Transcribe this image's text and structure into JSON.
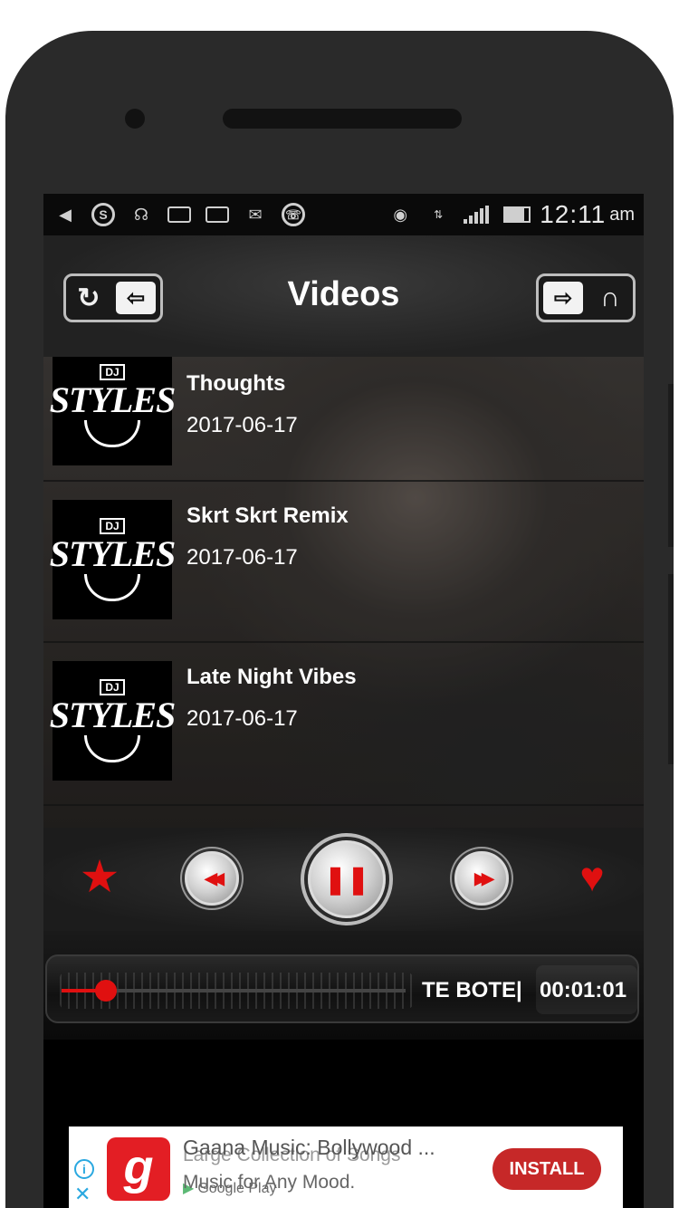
{
  "status_bar": {
    "time": "12:11",
    "ampm": "am"
  },
  "header": {
    "title": "Videos",
    "left_icons": [
      "refresh-icon",
      "back-arrow-icon"
    ],
    "right_icons": [
      "forward-arrow-icon",
      "headphones-icon"
    ]
  },
  "videos": [
    {
      "title": "Thoughts",
      "date": "2017-06-17",
      "thumb_badge": "DJ",
      "thumb_text": "STYLES"
    },
    {
      "title": "Skrt Skrt Remix",
      "date": "2017-06-17",
      "thumb_badge": "DJ",
      "thumb_text": "STYLES"
    },
    {
      "title": "Late Night Vibes",
      "date": "2017-06-17",
      "thumb_badge": "DJ",
      "thumb_text": "STYLES"
    }
  ],
  "controls": {
    "favorite_icon": "star-icon",
    "rewind_icon": "rewind-icon",
    "pause_icon": "pause-icon",
    "forward_icon": "fast-forward-icon",
    "like_icon": "heart-icon",
    "accent_color": "#e01010"
  },
  "player": {
    "marquee_text": "TE BOTE|",
    "elapsed": "00:01:01",
    "progress": 0.13
  },
  "ad": {
    "app_icon_letter": "g",
    "title": "Gaana Music: Bollywood ...",
    "subtitle": "Large Collection of Songs",
    "line2": "Music for Any Mood.",
    "store": "Google Play",
    "cta": "INSTALL",
    "cta_color": "#c62828"
  }
}
